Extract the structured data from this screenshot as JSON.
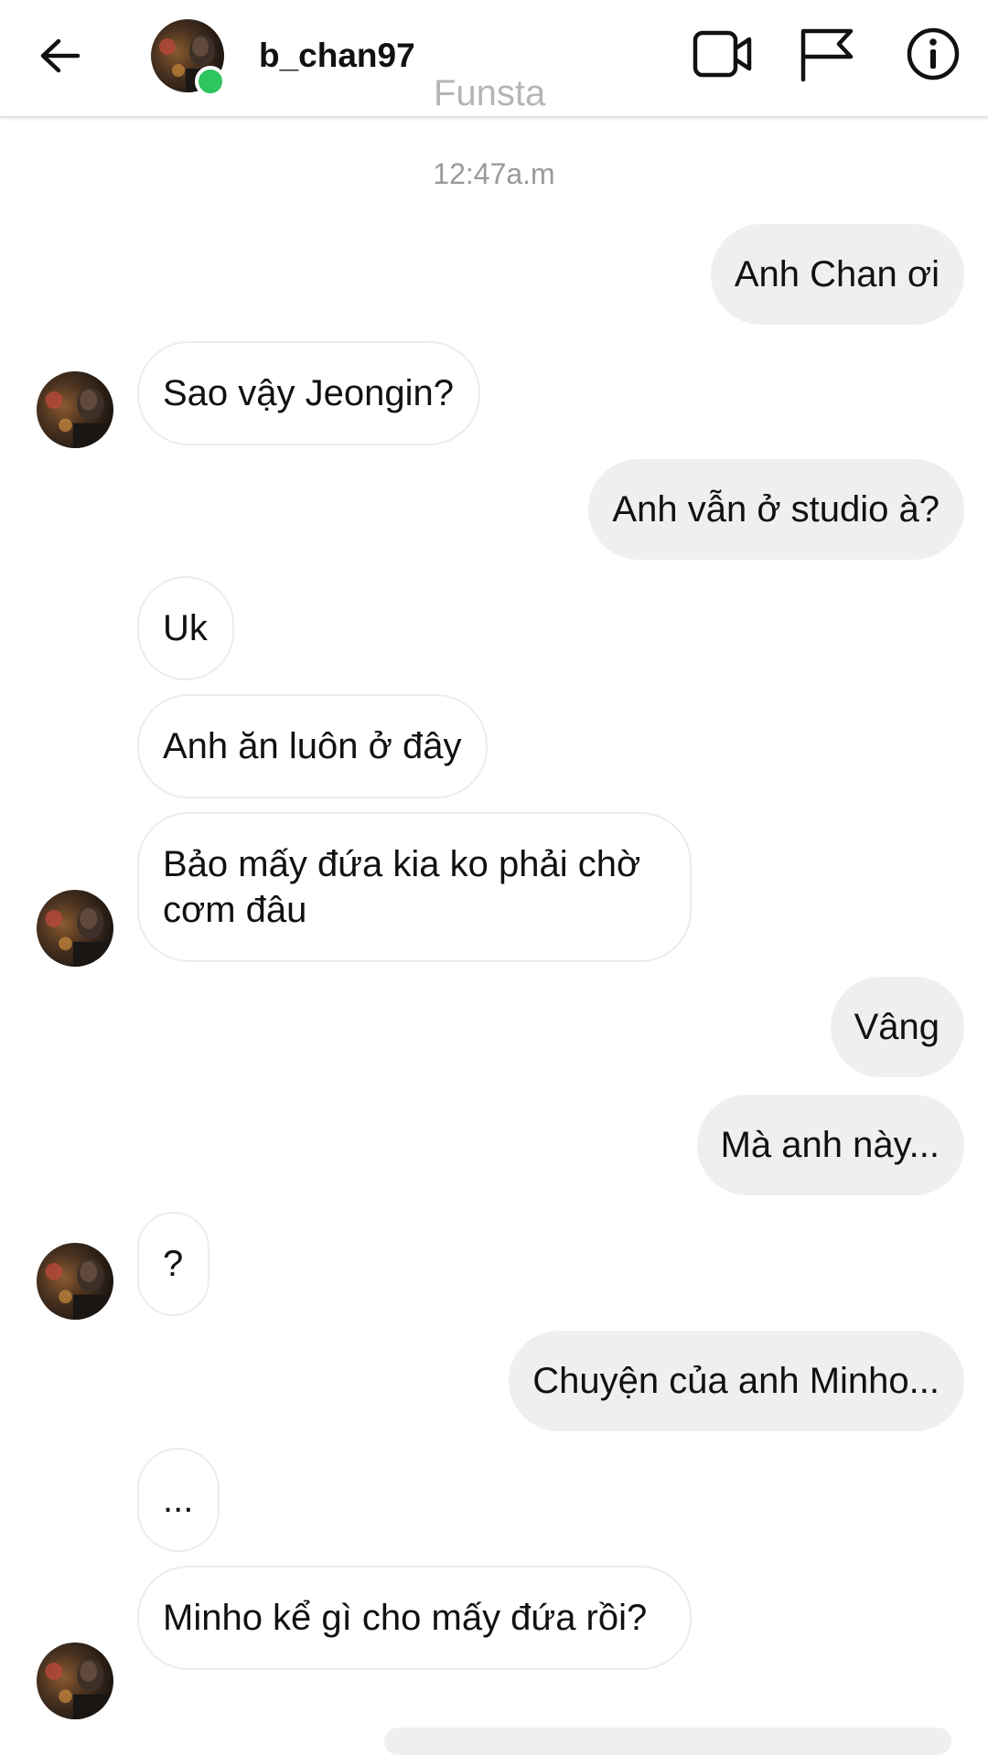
{
  "header": {
    "username": "b_chan97",
    "subtitle": "Funsta",
    "online": true
  },
  "chat": {
    "timestamp": "12:47a.m",
    "messages": [
      {
        "from": "me",
        "text": "Anh Chan ơi"
      },
      {
        "from": "them",
        "text": "Sao vậy Jeongin?"
      },
      {
        "from": "me",
        "text": "Anh vẫn ở studio à?"
      },
      {
        "from": "them",
        "text": "Uk"
      },
      {
        "from": "them",
        "text": "Anh ăn luôn ở đây"
      },
      {
        "from": "them",
        "text": "Bảo mấy đứa kia ko phải chờ cơm đâu"
      },
      {
        "from": "me",
        "text": "Vâng"
      },
      {
        "from": "me",
        "text": "Mà anh này..."
      },
      {
        "from": "them",
        "text": "?"
      },
      {
        "from": "me",
        "text": "Chuyện của anh Minho..."
      },
      {
        "from": "them",
        "text": "..."
      },
      {
        "from": "them",
        "text": "Minho kể gì cho mấy đứa rồi?"
      }
    ]
  },
  "icons": {
    "back": "arrow-left-icon",
    "video": "video-camera-icon",
    "report": "flag-icon",
    "info": "info-icon"
  },
  "colors": {
    "online": "#2ec55e",
    "outgoing_bubble": "#efefef",
    "incoming_border": "#ececec",
    "subtitle": "#b5b5b5",
    "timestamp": "#9a9a9a"
  }
}
